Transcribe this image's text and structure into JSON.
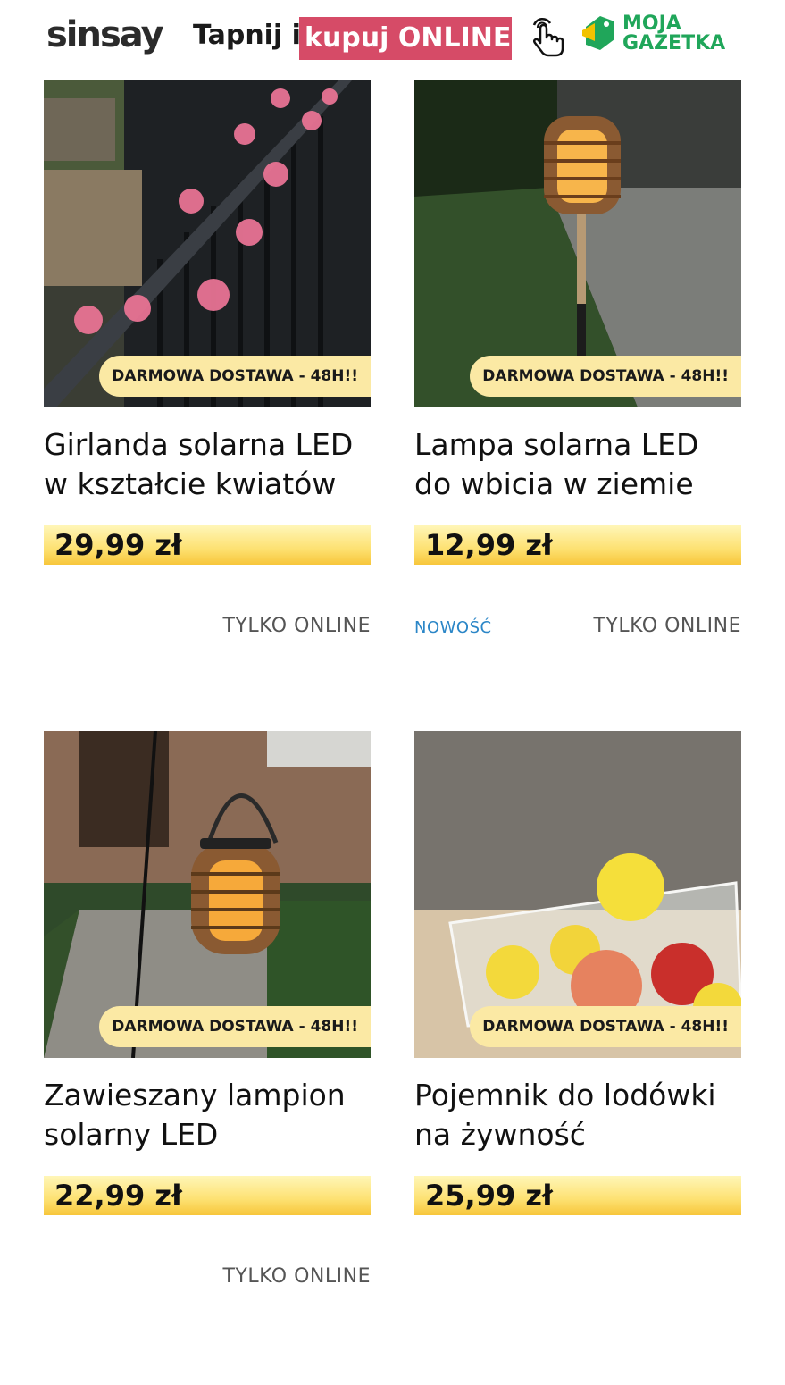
{
  "header": {
    "logo": "sinsay",
    "tagline_prefix": "Tapnij i",
    "tagline_highlight": "kupuj ONLINE",
    "partner_line1": "MOJA",
    "partner_line2": "GAZETKA",
    "tap_icon": "tap-hand-icon",
    "partner_icon": "moja-gazetka-tag-icon",
    "highlight_color": "#d64b67",
    "partner_color": "#20a65a"
  },
  "products": [
    {
      "title_line1": "Girlanda solarna LED",
      "title_line2": "w kształcie kwiatów",
      "price": "29,99 zł",
      "badge": "DARMOWA DOSTAWA - 48H!!",
      "online": "TYLKO ONLINE",
      "new": ""
    },
    {
      "title_line1": "Lampa solarna LED",
      "title_line2": "do wbicia w ziemie",
      "price": "12,99 zł",
      "badge": "DARMOWA DOSTAWA - 48H!!",
      "online": "TYLKO ONLINE",
      "new": "NOWOŚĆ"
    },
    {
      "title_line1": "Zawieszany lampion",
      "title_line2": "solarny LED",
      "price": "22,99 zł",
      "badge": "DARMOWA DOSTAWA - 48H!!",
      "online": "TYLKO ONLINE",
      "new": ""
    },
    {
      "title_line1": "Pojemnik do lodówki",
      "title_line2": "na żywność",
      "price": "25,99 zł",
      "badge": "DARMOWA DOSTAWA - 48H!!",
      "online": "",
      "new": ""
    }
  ],
  "colors": {
    "badge": "#fbe9a4",
    "price_band": "#fde171",
    "new_label": "#2b86c7"
  }
}
